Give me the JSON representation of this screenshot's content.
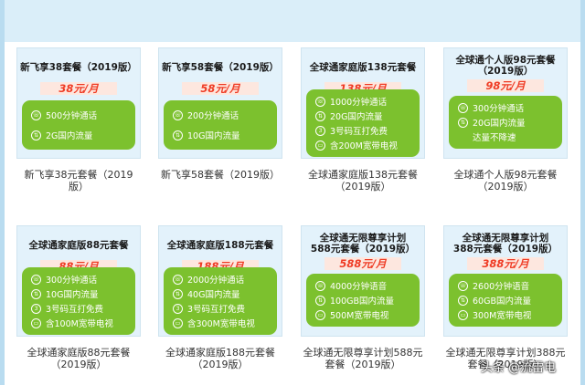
{
  "cards": [
    {
      "title": "新飞享38套餐（2019版）",
      "price": "38元/月",
      "features": [
        {
          "icon": "phone-icon",
          "text": "500分钟通话"
        },
        {
          "icon": "data-icon",
          "text": "2G国内流量"
        }
      ],
      "caption1": "新飞享38元套餐（2019",
      "caption2": "版）"
    },
    {
      "title": "新飞享58套餐（2019版）",
      "price": "58元/月",
      "features": [
        {
          "icon": "phone-icon",
          "text": "200分钟通话"
        },
        {
          "icon": "data-icon",
          "text": "10G国内流量"
        }
      ],
      "caption1": "新飞享58套餐（2019版）",
      "caption2": ""
    },
    {
      "title": "全球通家庭版138元套餐",
      "price": "138元/月",
      "features": [
        {
          "icon": "phone-icon",
          "text": "1000分钟通话"
        },
        {
          "icon": "data-icon",
          "text": "20G国内流量"
        },
        {
          "icon": "number-icon",
          "text": "3号码互打免费"
        },
        {
          "icon": "tv-icon",
          "text": "含200M宽带电视"
        }
      ],
      "caption1": "全球通家庭版138元套餐",
      "caption2": "（2019版）"
    },
    {
      "title": "全球通个人版98元套餐",
      "title2": "（2019版）",
      "price": "98元/月",
      "features": [
        {
          "icon": "phone-icon",
          "text": "300分钟通话"
        },
        {
          "icon": "data-icon",
          "text": "20G国内流量"
        },
        {
          "icon": "",
          "text": "达量不降速"
        }
      ],
      "caption1": "全球通个人版98元套餐",
      "caption2": "（2019版）"
    },
    {
      "title": "全球通家庭版88元套餐",
      "price": "88元/月",
      "features": [
        {
          "icon": "phone-icon",
          "text": "300分钟通话"
        },
        {
          "icon": "data-icon",
          "text": "10G国内流量"
        },
        {
          "icon": "number-icon",
          "text": "3号码互打免费"
        },
        {
          "icon": "tv-icon",
          "text": "含100M宽带电视"
        }
      ],
      "caption1": "全球通家庭版88元套餐",
      "caption2": "（2019版）"
    },
    {
      "title": "全球通家庭版188元套餐",
      "price": "188元/月",
      "features": [
        {
          "icon": "phone-icon",
          "text": "2000分钟通话"
        },
        {
          "icon": "data-icon",
          "text": "40G国内流量"
        },
        {
          "icon": "number-icon",
          "text": "3号码互打免费"
        },
        {
          "icon": "tv-icon",
          "text": "含300M宽带电视"
        }
      ],
      "caption1": "全球通家庭版188元套餐",
      "caption2": "（2019版）"
    },
    {
      "title": "全球通无限尊享计划",
      "title2": "588元套餐（2019版）",
      "price": "588元/月",
      "features": [
        {
          "icon": "phone-icon",
          "text": "4000分钟语音"
        },
        {
          "icon": "data-icon",
          "text": "100GB国内流量"
        },
        {
          "icon": "tv-icon",
          "text": "500M宽带电视"
        }
      ],
      "caption1": "全球通无限尊享计划588元",
      "caption2": "套餐（2019版）"
    },
    {
      "title": "全球通无限尊享计划",
      "title2": "388元套餐（2019版）",
      "price": "388元/月",
      "features": [
        {
          "icon": "phone-icon",
          "text": "2600分钟语音"
        },
        {
          "icon": "data-icon",
          "text": "60GB国内流量"
        },
        {
          "icon": "tv-icon",
          "text": "300M宽带电视"
        }
      ],
      "caption1": "全球通无限尊享计划388元",
      "caption2": "套餐（2019版）"
    }
  ],
  "watermark": "头条 @流雷电",
  "icon_glyphs": {
    "phone-icon": "☏",
    "data-icon": "⇅",
    "number-icon": "3",
    "tv-icon": "▭"
  },
  "colors": {
    "panel_green": "#7cc12e",
    "price_red": "#ef3b24",
    "poster_bg": "#e3f2fb",
    "top_bar": "#daeef9"
  }
}
